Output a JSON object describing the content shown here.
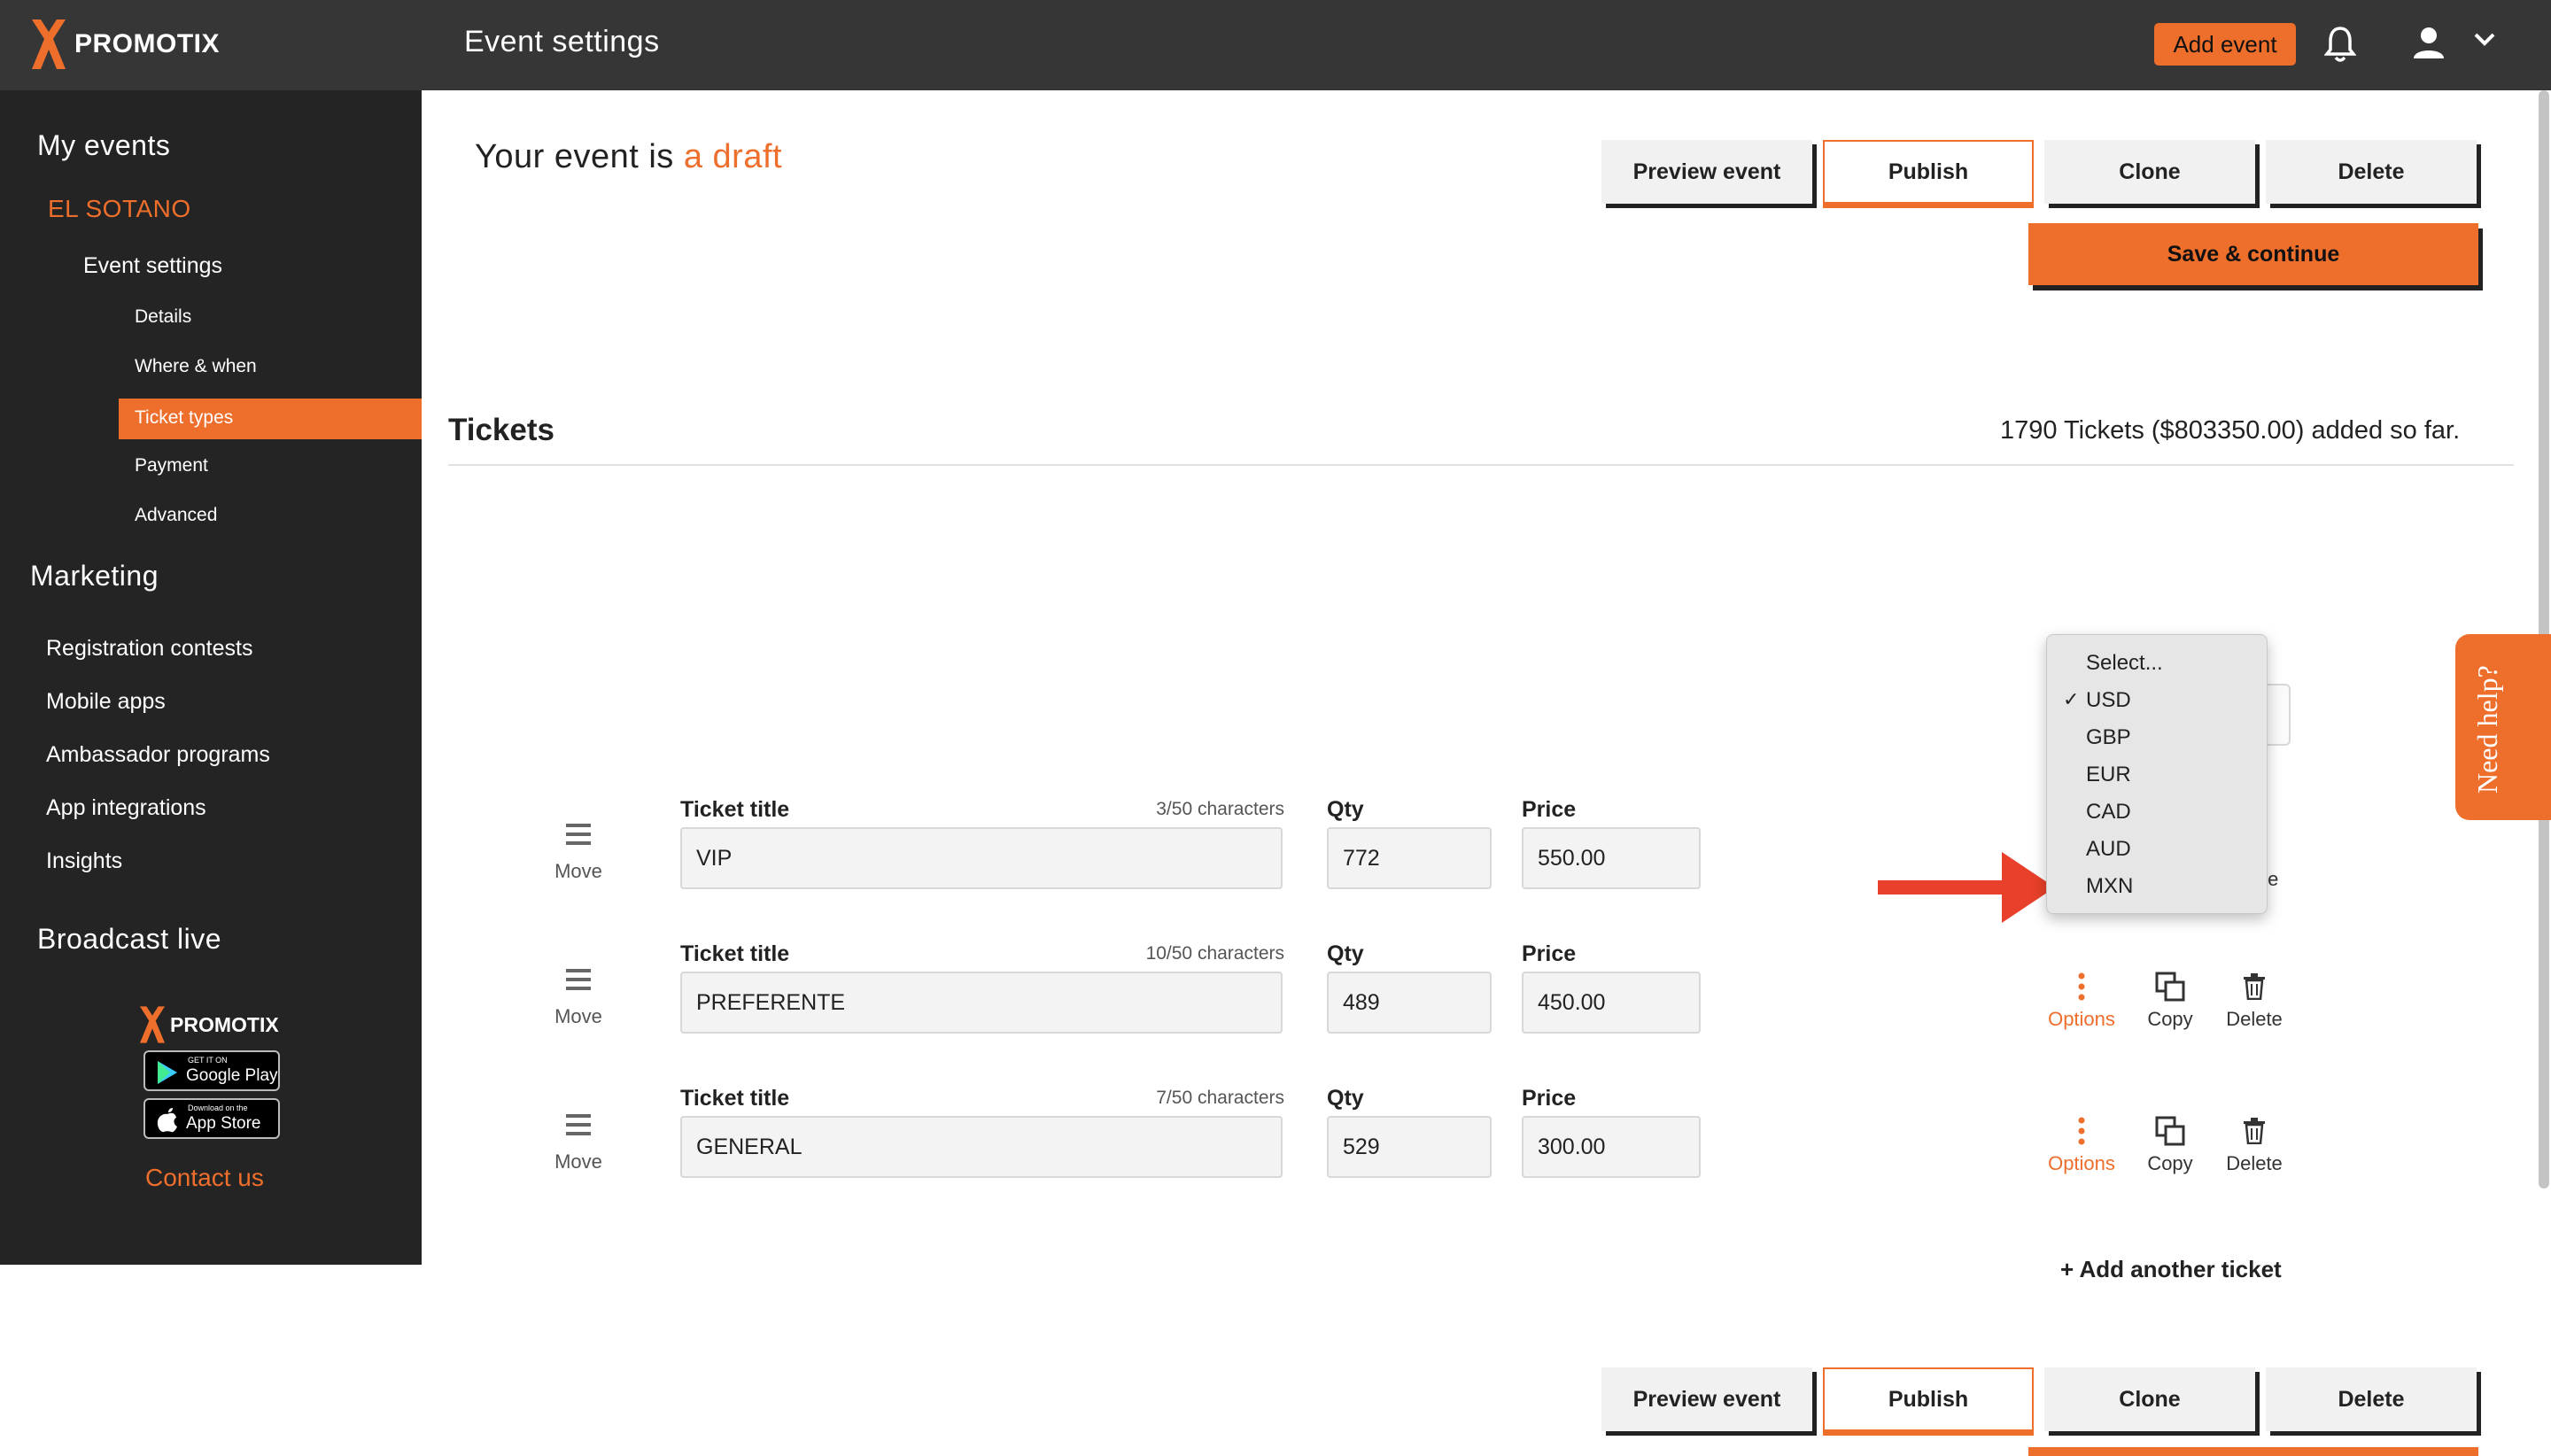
{
  "header": {
    "brand": "PROMOTIX",
    "title": "Event settings",
    "add_event": "Add event"
  },
  "sidebar": {
    "my_events": "My events",
    "event_name": "EL SOTANO",
    "event_settings": "Event settings",
    "sub_items": [
      "Details",
      "Where & when",
      "Ticket types",
      "Payment",
      "Advanced"
    ],
    "active_item": "Ticket types",
    "marketing": "Marketing",
    "marketing_items": [
      "Registration contests",
      "Mobile apps",
      "Ambassador programs",
      "App integrations",
      "Insights"
    ],
    "broadcast": "Broadcast live",
    "footer_brand": "PROMOTIX",
    "google_play_small": "GET IT ON",
    "google_play": "Google Play",
    "app_store_small": "Download on the",
    "app_store": "App Store",
    "contact": "Contact us"
  },
  "status": {
    "prefix": "Your event is",
    "state": "a draft"
  },
  "actions": {
    "preview": "Preview event",
    "publish": "Publish",
    "clone": "Clone",
    "delete": "Delete",
    "save": "Save & continue"
  },
  "tickets": {
    "heading": "Tickets",
    "summary": "1790 Tickets ($803350.00) added so far.",
    "rows": [
      {
        "title_label": "Ticket title",
        "count": "3/50 characters",
        "title": "VIP",
        "qty_label": "Qty",
        "qty": "772",
        "price_label": "Price",
        "price": "550.00",
        "move": "Move"
      },
      {
        "title_label": "Ticket title",
        "count": "10/50 characters",
        "title": "PREFERENTE",
        "qty_label": "Qty",
        "qty": "489",
        "price_label": "Price",
        "price": "450.00",
        "move": "Move"
      },
      {
        "title_label": "Ticket title",
        "count": "7/50 characters",
        "title": "GENERAL",
        "qty_label": "Qty",
        "qty": "529",
        "price_label": "Price",
        "price": "300.00",
        "move": "Move"
      }
    ],
    "row_actions": {
      "options": "Options",
      "copy": "Copy",
      "delete": "Delete"
    },
    "partial_delete": "te",
    "add_another": "Add another ticket"
  },
  "currency_dropdown": {
    "options": [
      "Select...",
      "USD",
      "GBP",
      "EUR",
      "CAD",
      "AUD",
      "MXN"
    ],
    "selected": "USD",
    "check": "✓"
  },
  "help": "Need help?",
  "colors": {
    "accent": "#ee6e2c",
    "topbar": "#363636",
    "sidebar": "#242424"
  }
}
